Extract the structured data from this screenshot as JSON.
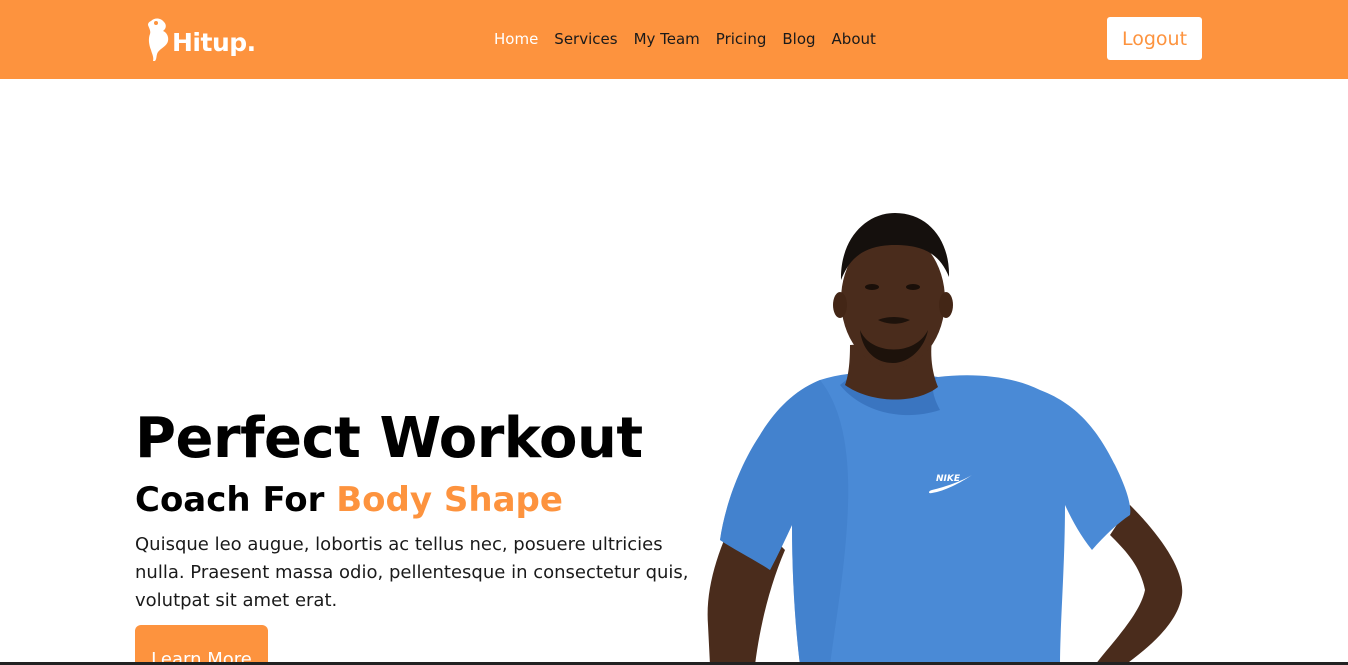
{
  "brand": {
    "name": "Hitup",
    "dot": ".",
    "logo_icon": "flexed-bicep-icon"
  },
  "nav": {
    "items": [
      {
        "label": "Home",
        "active": true
      },
      {
        "label": "Services",
        "active": false
      },
      {
        "label": "My Team",
        "active": false
      },
      {
        "label": "Pricing",
        "active": false
      },
      {
        "label": "Blog",
        "active": false
      },
      {
        "label": "About",
        "active": false
      }
    ],
    "logout_label": "Logout"
  },
  "hero": {
    "title": "Perfect Workout",
    "subtitle_prefix": "Coach For ",
    "subtitle_accent": "Body Shape",
    "paragraph": "Quisque leo augue, lobortis ac tellus nec, posuere ultricies nulla. Praesent massa odio, pellentesque in consectetur quis, volutpat sit amet erat.",
    "cta_label": "Learn More",
    "image_subject": "man-in-blue-tshirt",
    "shirt_logo": "NIKE"
  },
  "colors": {
    "accent": "#fd933e",
    "shirt": "#4a8ad6",
    "skin": "#4a2c1c"
  }
}
